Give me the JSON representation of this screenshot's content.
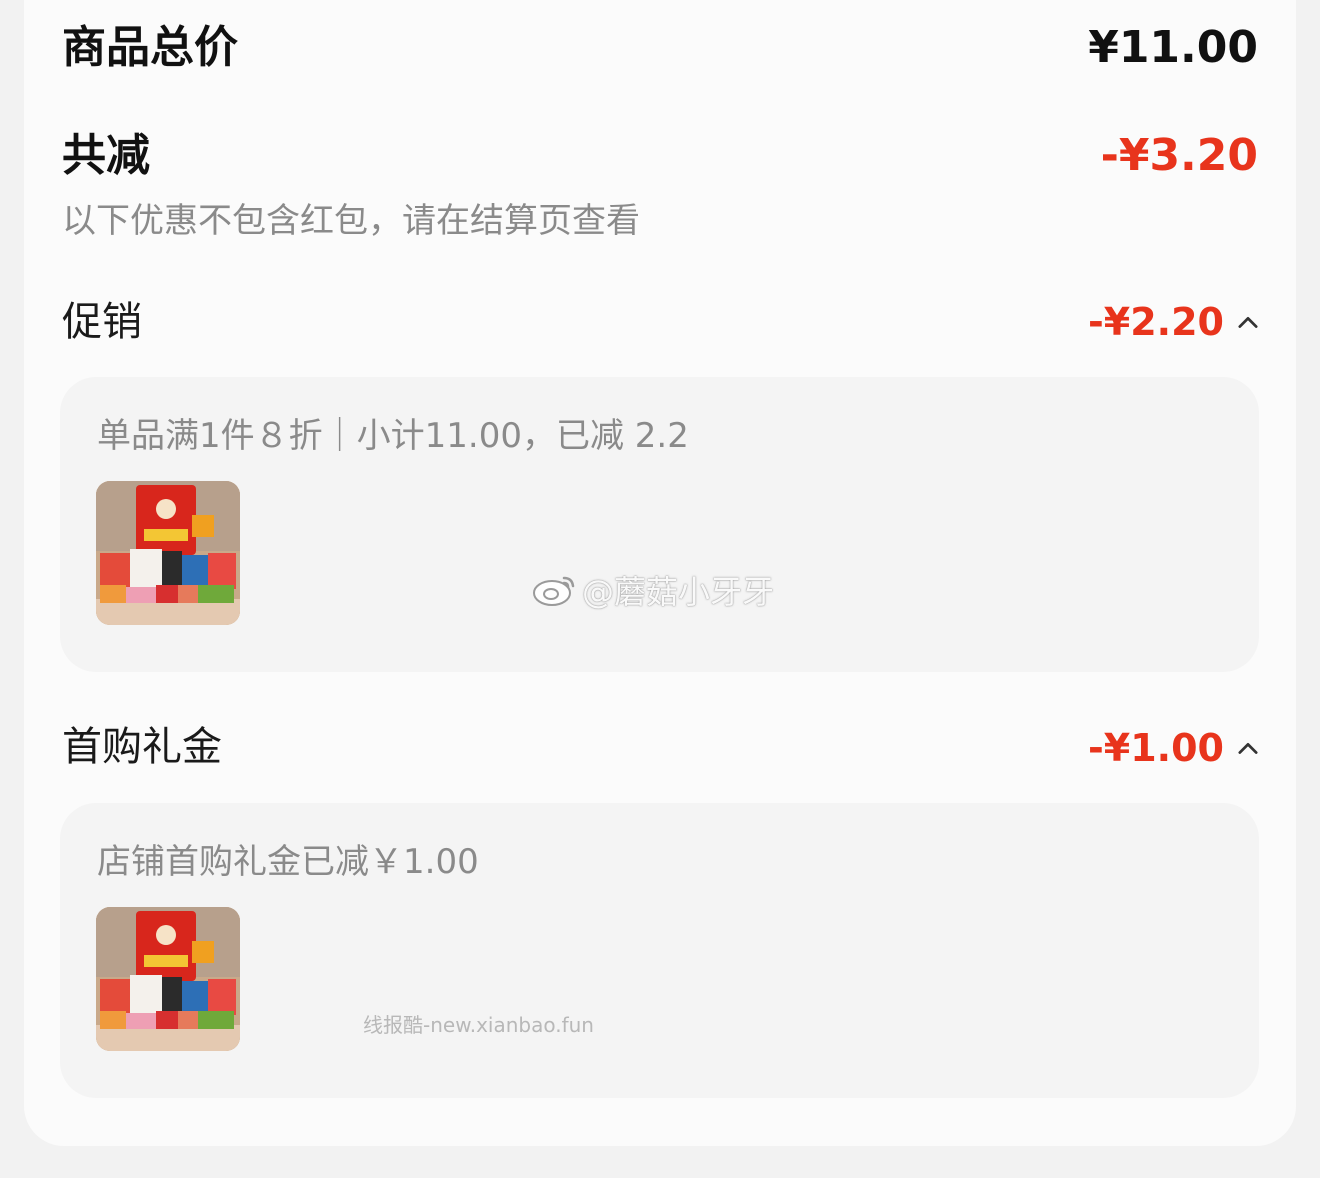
{
  "summary": {
    "total_label": "商品总价",
    "total_value": "¥11.00",
    "discount_label": "共减",
    "discount_value": "-¥3.20",
    "note": "以下优惠不包含红包，请在结算页查看"
  },
  "sections": [
    {
      "label": "促销",
      "amount": "-¥2.20",
      "expanded": true,
      "detail": "单品满1件８折｜小计11.00，已减 2.2",
      "product_image": "snack-gift-pack-image"
    },
    {
      "label": "首购礼金",
      "amount": "-¥1.00",
      "expanded": true,
      "detail": "店铺首购礼金已减￥1.00",
      "product_image": "snack-gift-pack-image"
    }
  ],
  "watermarks": {
    "weibo": "@蘑菇小牙牙",
    "site": "线报酷-new.xianbao.fun"
  },
  "colors": {
    "accent_red": "#e8341c",
    "text_dark": "#111111",
    "text_gray": "#8a8a8a",
    "panel_bg": "#f4f4f4",
    "card_bg": "#fbfbfb",
    "page_bg": "#f2f2f2"
  },
  "icons": {
    "collapse": "chevron-up-icon",
    "weibo": "weibo-logo-icon"
  }
}
